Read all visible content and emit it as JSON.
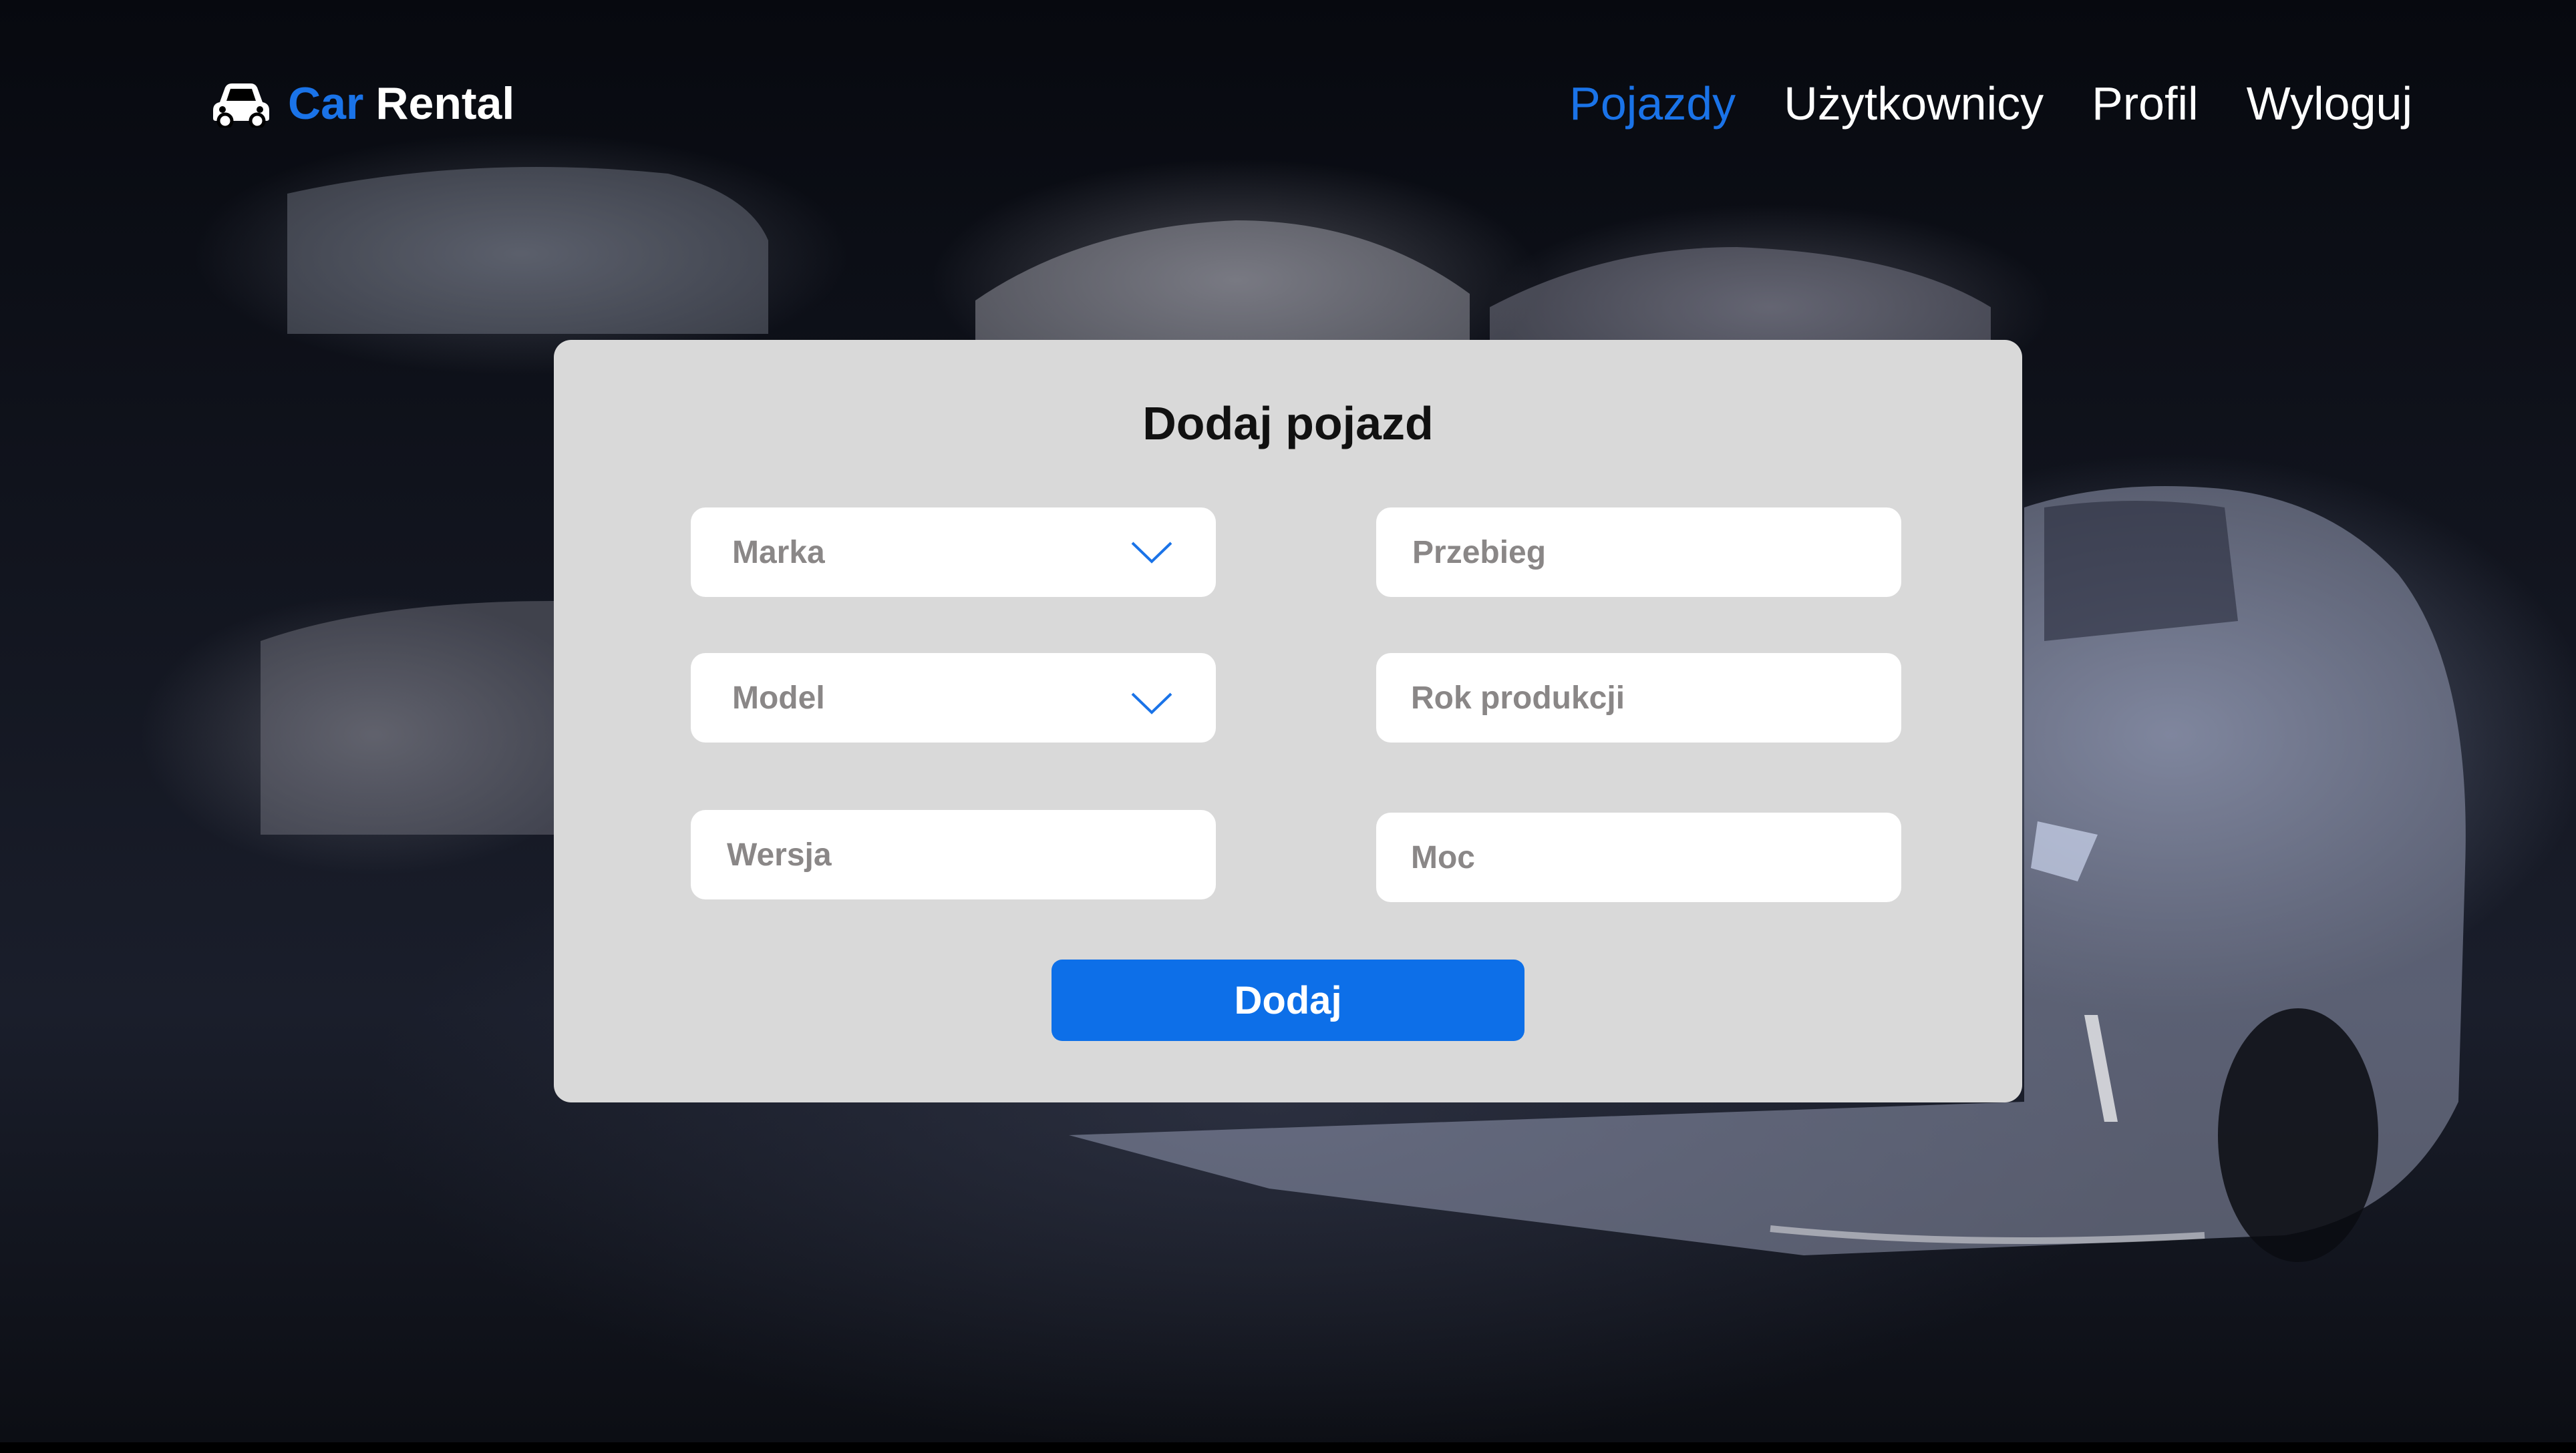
{
  "header": {
    "brand_part1": "Car",
    "brand_part2": "Rental",
    "logo_icon": "car-icon"
  },
  "nav": {
    "items": [
      {
        "label": "Pojazdy",
        "active": true
      },
      {
        "label": "Użytkownicy",
        "active": false
      },
      {
        "label": "Profil",
        "active": false
      },
      {
        "label": "Wyloguj",
        "active": false
      }
    ]
  },
  "form": {
    "title": "Dodaj pojazd",
    "brand_placeholder": "Marka",
    "model_placeholder": "Model",
    "version_placeholder": "Wersja",
    "mileage_placeholder": "Przebieg",
    "year_placeholder": "Rok produkcji",
    "power_placeholder": "Moc",
    "submit_label": "Dodaj",
    "dropdown_icon": "chevron-down-icon"
  },
  "colors": {
    "accent": "#1a73e8",
    "button": "#0d6fe8",
    "panel": "#d9d9d9",
    "placeholder_text": "#8a8787"
  }
}
